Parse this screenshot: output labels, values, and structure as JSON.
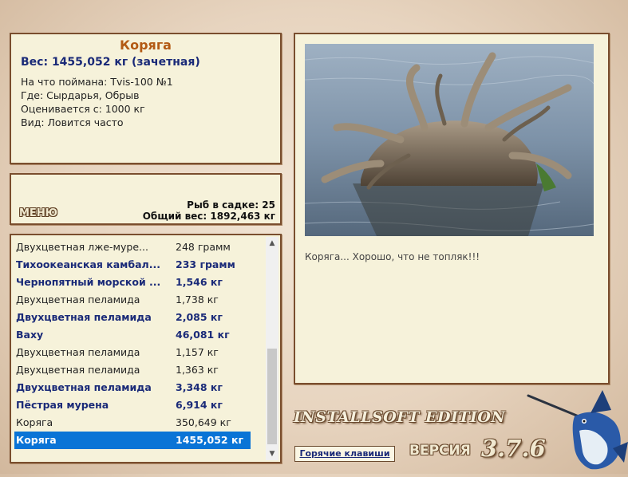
{
  "catch": {
    "title": "Коряга",
    "weight": "Вес: 1455,052 кг (зачетная)",
    "caught_on": "На что поймана: Tvis-100 №1",
    "where": "Где: Сырдарья, Обрыв",
    "valued_from": "Оценивается с: 1000 кг",
    "kind": "Вид: Ловится часто"
  },
  "status": {
    "menu_label": "МЕНЮ",
    "fish_count": "Рыб в садке: 25",
    "total_weight": "Общий вес: 1892,463 кг"
  },
  "list": {
    "rows": [
      {
        "name": "Двухцветная лже-муре...",
        "weight": "248 грамм",
        "style": "plain"
      },
      {
        "name": "Тихоокеанская камбал...",
        "weight": "233 грамм",
        "style": "bold"
      },
      {
        "name": "Чернопятный морской ...",
        "weight": "1,546 кг",
        "style": "bold"
      },
      {
        "name": "Двухцветная пеламида",
        "weight": "1,738 кг",
        "style": "plain"
      },
      {
        "name": "Двухцветная пеламида",
        "weight": "2,085 кг",
        "style": "bold"
      },
      {
        "name": "Ваху",
        "weight": "46,081 кг",
        "style": "bold"
      },
      {
        "name": "Двухцветная пеламида",
        "weight": "1,157 кг",
        "style": "plain"
      },
      {
        "name": "Двухцветная пеламида",
        "weight": "1,363 кг",
        "style": "plain"
      },
      {
        "name": "Двухцветная пеламида",
        "weight": "3,348 кг",
        "style": "bold"
      },
      {
        "name": "Пёстрая мурена",
        "weight": "6,914 кг",
        "style": "bold"
      },
      {
        "name": "Коряга",
        "weight": "350,649 кг",
        "style": "plain"
      },
      {
        "name": "Коряга",
        "weight": "1455,052 кг",
        "style": "selected"
      }
    ]
  },
  "photo": {
    "caption": "Коряга... Хорошо, что не топляк!!!"
  },
  "footer": {
    "edition": "INSTALLSOFT EDITION",
    "hotkeys_label": "Горячие клавиши",
    "version_label": "ВЕРСИЯ",
    "version_number": "3.7.6"
  },
  "colors": {
    "panel_bg": "#f6f2da",
    "panel_border": "#7a4e2e",
    "title_orange": "#b35a14",
    "accent_blue": "#1a2a78",
    "selection_blue": "#0a74d6"
  }
}
